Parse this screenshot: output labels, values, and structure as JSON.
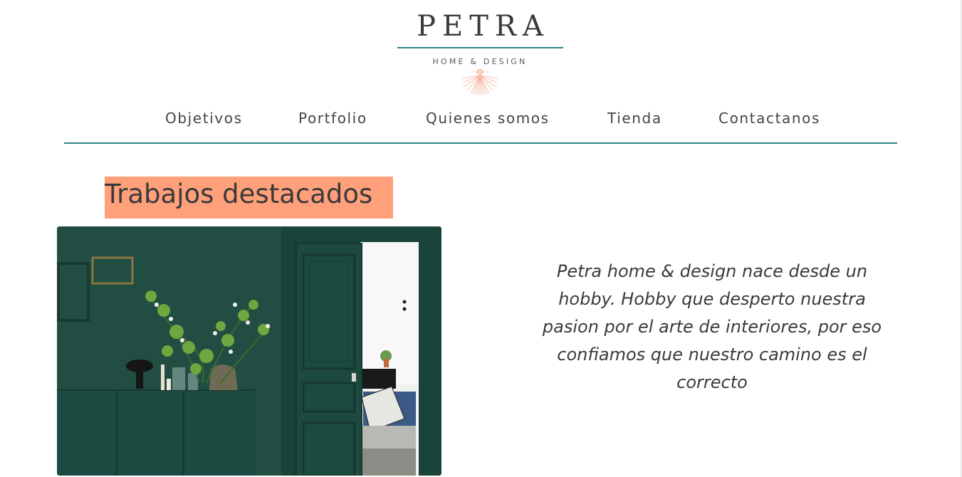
{
  "brand": {
    "name": "PETRA",
    "tagline": "HOME & DESIGN",
    "accent_color": "#2f8a84",
    "sun_color": "#f6a58a"
  },
  "nav": {
    "items": [
      {
        "label": "Objetivos"
      },
      {
        "label": "Portfolio"
      },
      {
        "label": "Quienes somos"
      },
      {
        "label": "Tienda"
      },
      {
        "label": "Contactanos"
      }
    ]
  },
  "main": {
    "section_title": "Trabajos destacados",
    "section_title_bg": "#ffa07a",
    "about_text": "Petra home & design nace desde un hobby. Hobby que desperto nuestra pasion por el arte de interiores, por eso confiamos que nuestro camino es el correcto",
    "photo": {
      "icon": "interior-photo",
      "wall_color": "#1f4a40"
    }
  }
}
